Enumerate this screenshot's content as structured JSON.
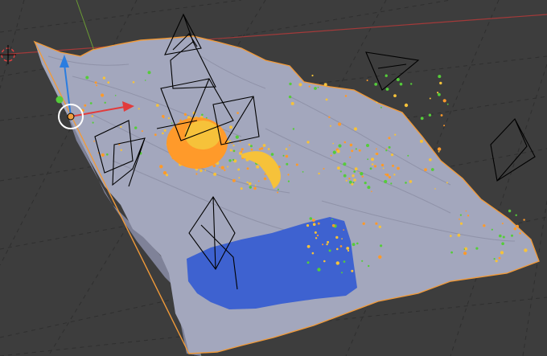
{
  "viewport": {
    "background": "#3d3d3d",
    "grid_color": "#2f2f2f",
    "x_axis_color": "#a33a3a",
    "y_axis_color": "#6a9a35",
    "mesh_color": "#a3a7bd",
    "mesh_shadow": "#7f8298",
    "selection_outline": "#f09a3a",
    "water_color": "#3e62d0",
    "vegetation_colors": [
      "#ff9a2a",
      "#f6c23a",
      "#55cc3a"
    ],
    "camera_wire_color": "#000000"
  },
  "gizmo": {
    "x_arrow_color": "#e23b3b",
    "y_arrow_color": "#3b8fe2",
    "z_arrow_color": "#2a7de0",
    "rotate_circle_color": "#ffffff",
    "icons": [
      "translate-arrow-x-icon",
      "translate-arrow-z-icon",
      "rotate-circle-icon",
      "object-origin-icon"
    ]
  },
  "cursor": {
    "icon": "3d-cursor-icon",
    "ring_color": "#e04040"
  },
  "cameras": {
    "icon": "camera-wireframe-icon",
    "count": 9
  }
}
